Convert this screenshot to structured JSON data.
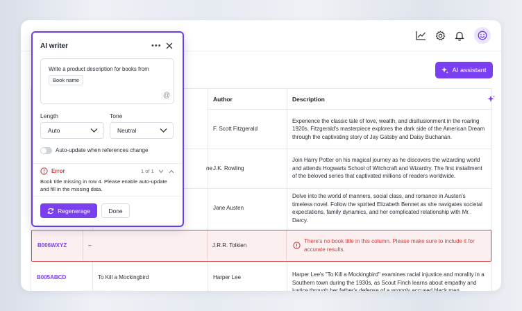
{
  "header": {
    "icons": [
      "chart-icon",
      "gear-icon",
      "bell-icon",
      "smiley-icon"
    ]
  },
  "toolbar": {
    "ai_assistant_label": "AI assistant"
  },
  "table": {
    "columns": [
      "Author",
      "Description"
    ],
    "rows": [
      {
        "code": "",
        "title": "",
        "author": "F. Scott Fitzgerald",
        "description": "Experience the classic tale of love, wealth, and disillusionment in the roaring 1920s. Fitzgerald's masterpiece explores the dark side of the American Dream through the captivating story of Jay Gatsby and Daisy Buchanan."
      },
      {
        "code": "",
        "title": "ne",
        "author": "J.K. Rowling",
        "description": "Join Harry Potter on his magical journey as he discovers the wizarding world and attends Hogwarts School of Witchcraft and Wizardry. The first installment of the beloved series that captivated millions of readers worldwide."
      },
      {
        "code": "",
        "title": "",
        "author": "Jane Austen",
        "description": "Delve into the world of manners, social class, and romance in Austen's timeless novel. Follow the spirited Elizabeth Bennet as she navigates societal expectations, family dynamics, and her complicated relationship with Mr. Darcy."
      },
      {
        "code": "B006WXYZ",
        "title": "–",
        "author": "J.R.R. Tolkien",
        "description": "There's no book title in this column. Please make sure to include it for accurate results.",
        "error": true
      },
      {
        "code": "B005ABCD",
        "title": "To Kill a Mockingbird",
        "author": "Harper Lee",
        "description": "Harper Lee's \"To Kill a Mockingbird\" examines racial injustice and morality in a Southern town during the 1930s, as Scout Finch learns about empathy and justice through her father's defense of a wrongly accused black man."
      }
    ]
  },
  "panel": {
    "title": "AI writer",
    "prompt_text": "Write a product description for books from",
    "chip": "Book name",
    "length_label": "Length",
    "length_value": "Auto",
    "tone_label": "Tone",
    "tone_value": "Neutral",
    "toggle_label": "Auto-update when references change",
    "error_title": "Error",
    "error_count": "1 of 1",
    "error_message": "Book title missing in row 4. Please enable auto-update and fill in the missing data.",
    "regen_label": "Regenerage",
    "done_label": "Done"
  },
  "colors": {
    "accent": "#7b3ff2",
    "error": "#d43c3c",
    "error_bg": "#fbeff0"
  }
}
